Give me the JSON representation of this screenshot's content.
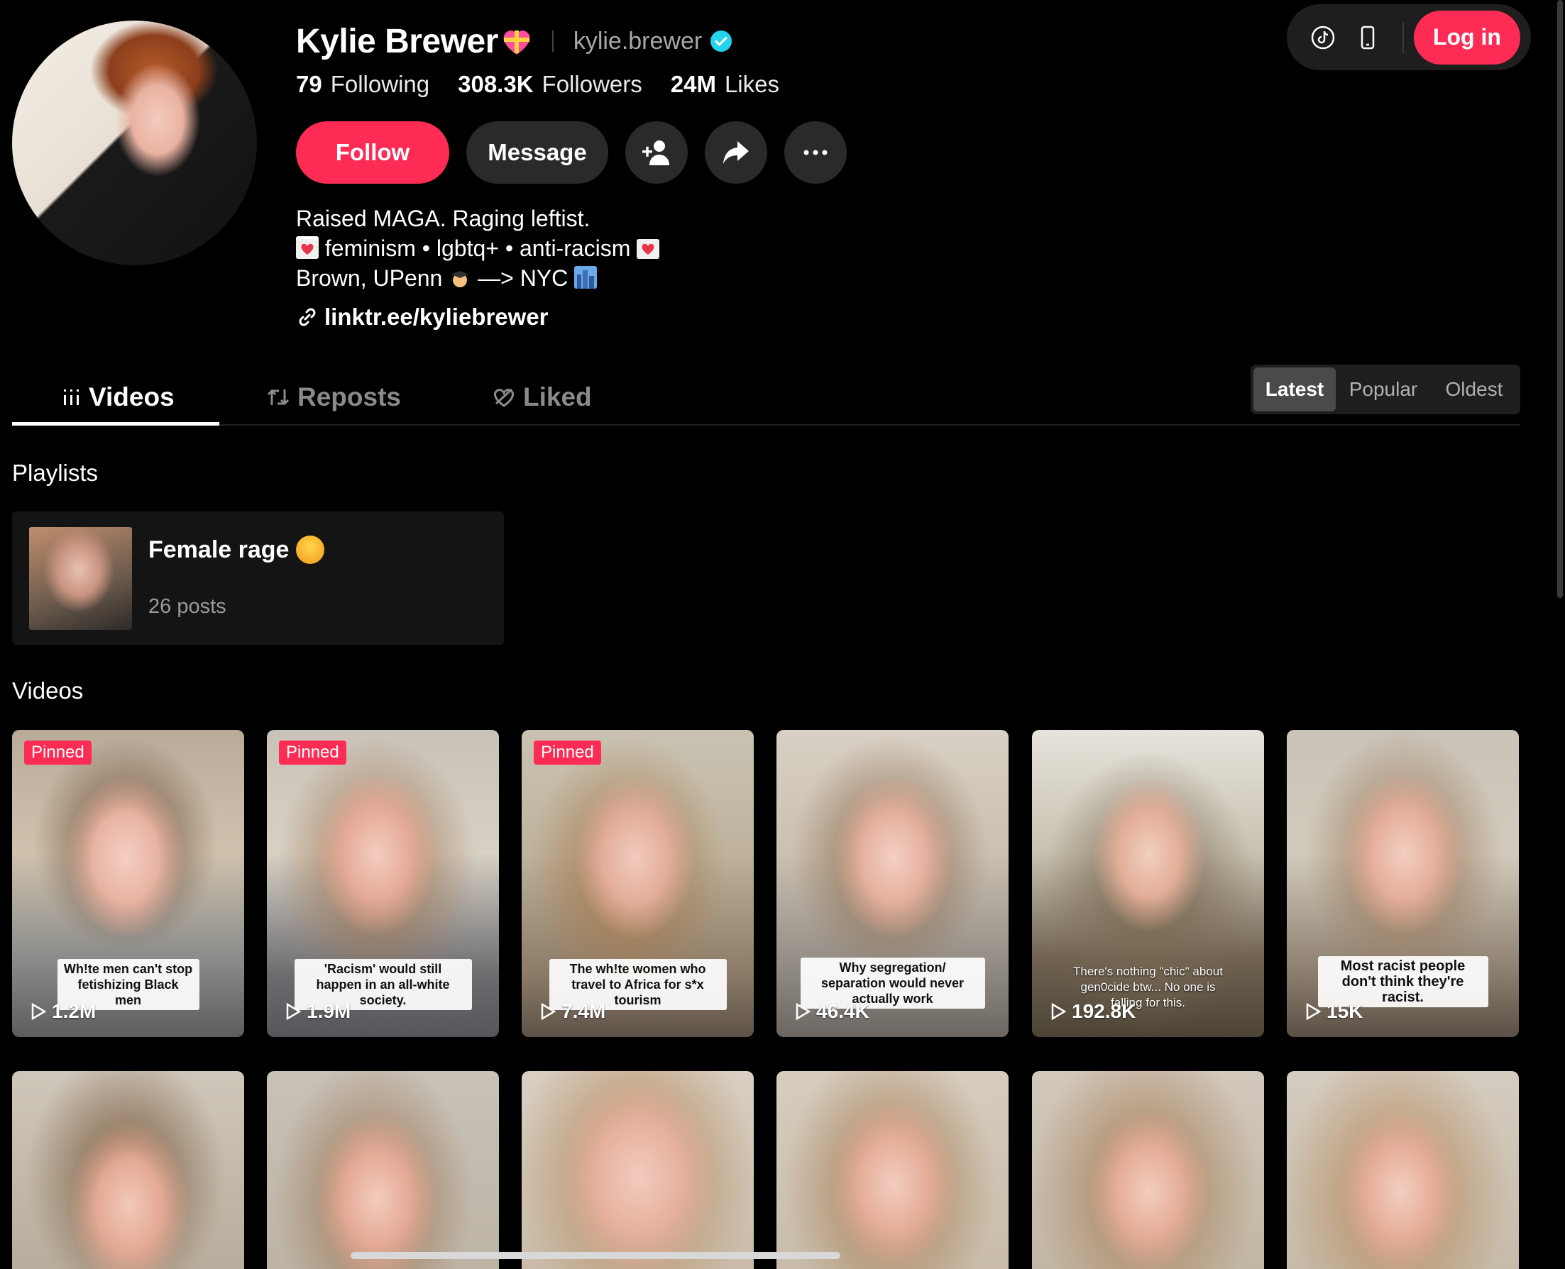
{
  "topbar": {
    "login_label": "Log in"
  },
  "profile": {
    "name": "Kylie Brewer",
    "handle": "kylie.brewer",
    "stats": [
      {
        "value": "79",
        "label": "Following"
      },
      {
        "value": "308.3K",
        "label": "Followers"
      },
      {
        "value": "24M",
        "label": "Likes"
      }
    ],
    "follow_label": "Follow",
    "message_label": "Message",
    "bio": {
      "line1": "Raised MAGA. Raging leftist.",
      "line2": "feminism • lgbtq+ • anti-racism",
      "line3a": "Brown, UPenn",
      "line3b": "—> NYC"
    },
    "link": "linktr.ee/kyliebrewer"
  },
  "tabs": [
    {
      "label": "Videos"
    },
    {
      "label": "Reposts"
    },
    {
      "label": "Liked"
    }
  ],
  "sort_options": [
    {
      "label": "Latest"
    },
    {
      "label": "Popular"
    },
    {
      "label": "Oldest"
    }
  ],
  "playlists_heading": "Playlists",
  "playlist": {
    "title": "Female rage",
    "posts": "26 posts"
  },
  "videos_heading": "Videos",
  "pinned_label": "Pinned",
  "videos": [
    {
      "caption": "Wh!te men can't stop fetishizing Black men",
      "views": "1.2M"
    },
    {
      "caption": "'Racism' would still happen in an all-white society.",
      "views": "1.9M"
    },
    {
      "caption": "The wh!te women who travel to Africa for s*x tourism",
      "views": "7.4M"
    },
    {
      "caption": "Why segregation/ separation would never actually work",
      "views": "46.4K"
    },
    {
      "caption": "There's nothing \"chic\" about gen0cide btw... No one is falling for this.",
      "views": "192.8K"
    },
    {
      "caption": "Most racist people don't think they're racist.",
      "views": "15K"
    }
  ],
  "colors": {
    "accent": "#fe2c55",
    "verified": "#20d5ec",
    "background": "#000000"
  }
}
